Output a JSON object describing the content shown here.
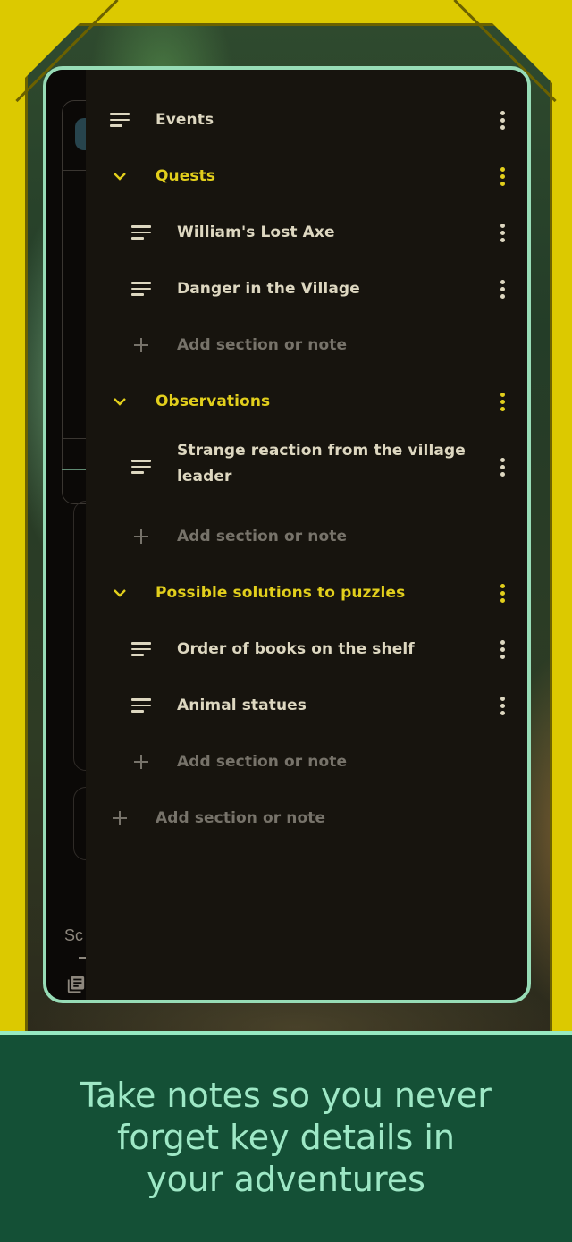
{
  "colors": {
    "background_yellow": "#dcc900",
    "phone_border": "#97dcb6",
    "drawer_bg": "#17140e",
    "section_accent": "#e2cf1c",
    "note_text": "#ddd7c0",
    "add_text": "#77736a",
    "band_green": "#145036",
    "tagline_text": "#9ee8c6"
  },
  "background_app": {
    "partial_label": "Sc"
  },
  "drawer": {
    "items": [
      {
        "type": "note",
        "level": 0,
        "icon": "notes-lines-icon",
        "label": "Events"
      },
      {
        "type": "section",
        "level": 0,
        "icon": "chevron-down-icon",
        "label": "Quests",
        "expanded": true
      },
      {
        "type": "note",
        "level": 1,
        "icon": "notes-lines-icon",
        "label": "William's Lost Axe"
      },
      {
        "type": "note",
        "level": 1,
        "icon": "notes-lines-icon",
        "label": "Danger in the Village"
      },
      {
        "type": "add",
        "level": 1,
        "icon": "plus-icon",
        "label": "Add section or note"
      },
      {
        "type": "section",
        "level": 0,
        "icon": "chevron-down-icon",
        "label": "Observations",
        "expanded": true
      },
      {
        "type": "note",
        "level": 1,
        "icon": "notes-lines-icon",
        "label_line1": "Strange reaction from the village",
        "label_line2": "leader"
      },
      {
        "type": "add",
        "level": 1,
        "icon": "plus-icon",
        "label": "Add section or note"
      },
      {
        "type": "section",
        "level": 0,
        "icon": "chevron-down-icon",
        "label": "Possible solutions to puzzles",
        "expanded": true
      },
      {
        "type": "note",
        "level": 1,
        "icon": "notes-lines-icon",
        "label": "Order of books on the shelf"
      },
      {
        "type": "note",
        "level": 1,
        "icon": "notes-lines-icon",
        "label": "Animal statues"
      },
      {
        "type": "add",
        "level": 1,
        "icon": "plus-icon",
        "label": "Add section or note"
      },
      {
        "type": "add",
        "level": 0,
        "icon": "plus-icon",
        "label": "Add section or note"
      }
    ],
    "more_icon": "more-vertical-icon"
  },
  "tagline": {
    "line1": "Take notes so you never",
    "line2": "forget key details in",
    "line3": "your adventures"
  }
}
